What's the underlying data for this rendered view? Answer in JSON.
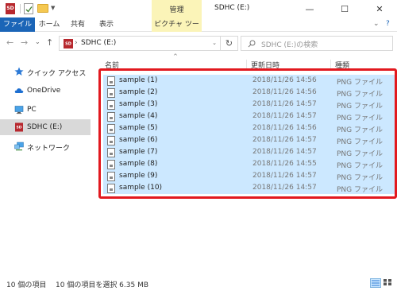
{
  "titlebar": {
    "context_tab_group": "管理",
    "window_title": "SDHC (E:)",
    "minimize": "—",
    "maximize": "☐",
    "close": "✕",
    "quick_access_dropdown": "▼"
  },
  "ribbon": {
    "tabs": [
      "ファイル",
      "ホーム",
      "共有",
      "表示",
      "ピクチャ ツール"
    ],
    "expand": "⌄",
    "help": "?"
  },
  "address_bar": {
    "back": "←",
    "forward": "→",
    "history_dropdown": "⌄",
    "up": "↑",
    "path_separator": "›",
    "path": "SDHC (E:)",
    "dropdown": "⌄",
    "refresh": "↻",
    "search_placeholder": "SDHC (E:)の検索"
  },
  "navigation": {
    "items": [
      {
        "label": "クイック アクセス",
        "icon": "star-icon"
      },
      {
        "label": "OneDrive",
        "icon": "cloud-icon"
      },
      {
        "label": "PC",
        "icon": "computer-icon"
      },
      {
        "label": "SDHC (E:)",
        "icon": "sd-card-icon",
        "selected": true
      },
      {
        "label": "ネットワーク",
        "icon": "network-icon"
      }
    ]
  },
  "file_list": {
    "sort_indicator": "^",
    "columns": [
      "名前",
      "更新日時",
      "種類"
    ],
    "rows": [
      {
        "name": "sample (1)",
        "date": "2018/11/26 14:56",
        "type": "PNG ファイル"
      },
      {
        "name": "sample (2)",
        "date": "2018/11/26 14:56",
        "type": "PNG ファイル"
      },
      {
        "name": "sample (3)",
        "date": "2018/11/26 14:57",
        "type": "PNG ファイル"
      },
      {
        "name": "sample (4)",
        "date": "2018/11/26 14:57",
        "type": "PNG ファイル"
      },
      {
        "name": "sample (5)",
        "date": "2018/11/26 14:56",
        "type": "PNG ファイル"
      },
      {
        "name": "sample (6)",
        "date": "2018/11/26 14:57",
        "type": "PNG ファイル"
      },
      {
        "name": "sample (7)",
        "date": "2018/11/26 14:57",
        "type": "PNG ファイル"
      },
      {
        "name": "sample (8)",
        "date": "2018/11/26 14:55",
        "type": "PNG ファイル"
      },
      {
        "name": "sample (9)",
        "date": "2018/11/26 14:57",
        "type": "PNG ファイル"
      },
      {
        "name": "sample (10)",
        "date": "2018/11/26 14:57",
        "type": "PNG ファイル"
      }
    ]
  },
  "status": {
    "item_count": "10 個の項目",
    "selection": "10 個の項目を選択  6.35 MB"
  },
  "colors": {
    "file_tab": "#1b65b7",
    "context_tab": "#fbf4b8",
    "selection": "#cce8ff",
    "highlight_outline": "#e2191f"
  }
}
